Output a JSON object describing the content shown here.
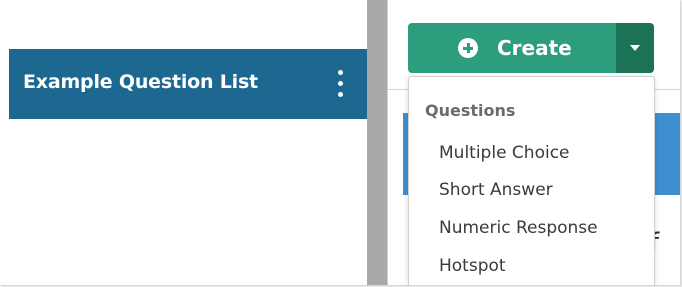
{
  "left_pane": {
    "list_title": "Example Question List",
    "menu_icon": "kebab-vertical-icon"
  },
  "right_pane": {
    "behind_text": "of"
  },
  "create": {
    "label": "Create",
    "icon": "plus-circle-icon",
    "caret_icon": "caret-down-icon",
    "colors": {
      "primary": "#2c9e7e",
      "caret": "#1b7257"
    }
  },
  "dropdown": {
    "heading": "Questions",
    "items": [
      "Multiple Choice",
      "Short Answer",
      "Numeric Response",
      "Hotspot"
    ]
  },
  "colors": {
    "header_bg": "#1c6891",
    "splitter": "#a9a9a9",
    "blue_band": "#3d8fd2"
  }
}
